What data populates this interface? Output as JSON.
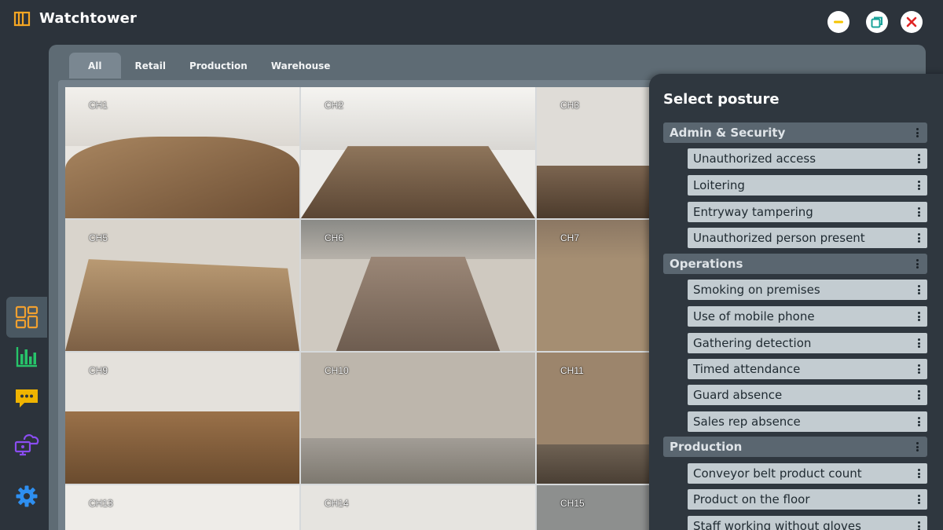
{
  "app": {
    "title": "Watchtower",
    "accent": "#f5a623"
  },
  "window_controls": {
    "minimize_color": "#f5c400",
    "maximize_color": "#1aa39a",
    "close_color": "#e02424"
  },
  "rail": {
    "items": [
      {
        "icon": "grid-view-icon",
        "color": "#f0a030",
        "active": true
      },
      {
        "icon": "bar-chart-icon",
        "color": "#27c46a"
      },
      {
        "icon": "chat-message-icon",
        "color": "#f0b400"
      },
      {
        "icon": "cloud-devices-icon",
        "color": "#8a4df0"
      },
      {
        "icon": "gear-icon",
        "color": "#2e8ff0"
      }
    ]
  },
  "tabs": [
    {
      "label": "All",
      "active": true
    },
    {
      "label": "Retail"
    },
    {
      "label": "Production"
    },
    {
      "label": "Warehouse"
    }
  ],
  "cameras": [
    {
      "label": "CH1"
    },
    {
      "label": "CH2"
    },
    {
      "label": "CH3"
    },
    {
      "label": "CH5"
    },
    {
      "label": "CH6"
    },
    {
      "label": "CH7"
    },
    {
      "label": "CH9"
    },
    {
      "label": "CH10"
    },
    {
      "label": "CH11"
    },
    {
      "label": "CH13"
    },
    {
      "label": "CH14"
    },
    {
      "label": "CH15"
    }
  ],
  "posture": {
    "title": "Select posture",
    "groups": [
      {
        "label": "Admin & Security",
        "items": [
          "Unauthorized access",
          "Loitering",
          "Entryway tampering",
          "Unauthorized person present"
        ]
      },
      {
        "label": "Operations",
        "items": [
          "Smoking on premises",
          "Use of mobile phone",
          "Gathering detection",
          "Timed attendance",
          "Guard absence",
          "Sales rep absence"
        ]
      },
      {
        "label": "Production",
        "items": [
          "Conveyor belt product count",
          "Product on the floor",
          "Staff working without gloves"
        ]
      }
    ]
  }
}
